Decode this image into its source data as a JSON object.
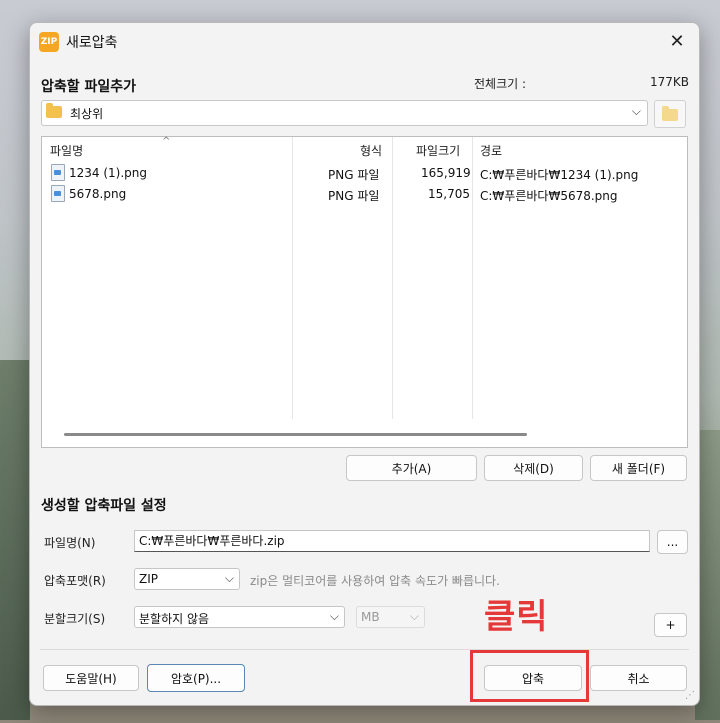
{
  "window": {
    "title": "새로압축",
    "app_icon_text": "ZIP",
    "close_glyph": "✕"
  },
  "source": {
    "section_title": "압축할 파일추가",
    "total_size_label": "전체크기 :",
    "total_size_value": "177KB",
    "path": "최상위",
    "sort_indicator": "^",
    "columns": {
      "name": "파일명",
      "type": "형식",
      "size": "파일크기",
      "path": "경로"
    },
    "files": [
      {
        "name": "1234 (1).png",
        "type": "PNG 파일",
        "size": "165,919",
        "path": "C:₩푸른바다₩1234 (1).png"
      },
      {
        "name": "5678.png",
        "type": "PNG 파일",
        "size": "15,705",
        "path": "C:₩푸른바다₩5678.png"
      }
    ],
    "buttons": {
      "add": "추가(A)",
      "delete": "삭제(D)",
      "new_folder": "새 폴더(F)"
    }
  },
  "output": {
    "section_title": "생성할 압축파일 설정",
    "filename_label": "파일명(N)",
    "filename_value": "C:₩푸른바다₩푸른바다.zip",
    "browse_label": "...",
    "format_label": "압축포맷(R)",
    "format_value": "ZIP",
    "format_hint": "zip은 멀티코어를 사용하여 압축 속도가 빠릅니다.",
    "split_label": "분할크기(S)",
    "split_value": "분할하지 않음",
    "split_unit": "MB",
    "plus_label": "+"
  },
  "footer": {
    "help": "도움말(H)",
    "password": "암호(P)...",
    "compress": "압축",
    "cancel": "취소"
  },
  "annotation": {
    "text": "클릭",
    "color": "#e53939"
  }
}
